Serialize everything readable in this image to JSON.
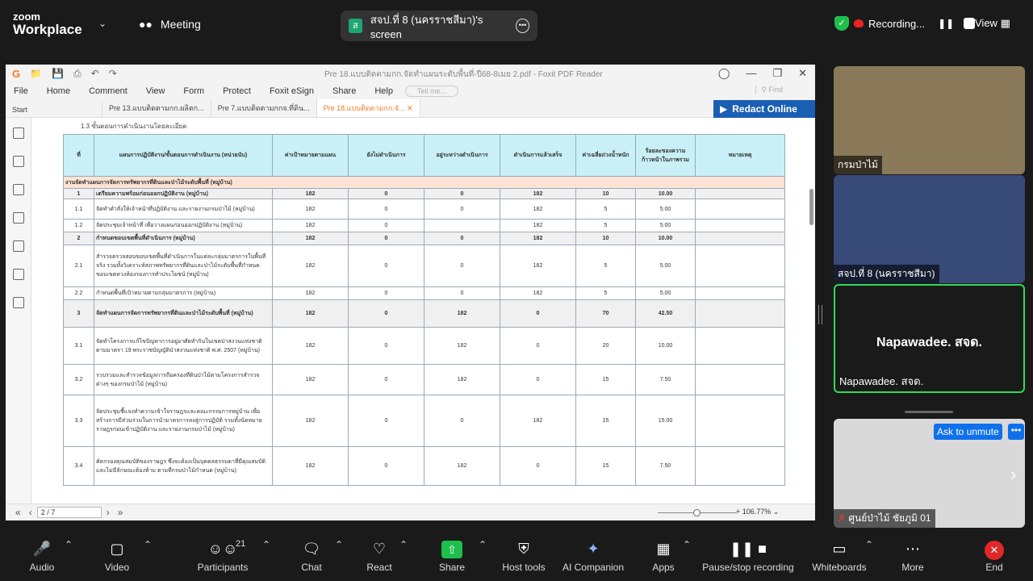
{
  "zoom": {
    "brand_line1": "zoom",
    "brand_line2": "Workplace",
    "meeting_label": "Meeting",
    "share_tab": {
      "avatar_letter": "ส",
      "title": "สจป.ที่ 8 (นครราชสีมา)'s screen"
    },
    "recording_label": "Recording...",
    "view_label": "View"
  },
  "pdf": {
    "window_title": "Pre 18.แบบติดตามกก.จัดทำแผนระดับพื้นที่-ปี68-8เมย 2.pdf - Foxit PDF Reader",
    "menu": [
      "File",
      "Home",
      "Comment",
      "View",
      "Form",
      "Protect",
      "Foxit eSign",
      "Share",
      "Help"
    ],
    "tell_me_placeholder": "Tell me...",
    "find_placeholder": "Find",
    "tabs": [
      "Start",
      "Pre 13.แบบติดตามกก.ผลิตก...",
      "Pre 7.แบบติดตามกกจ.ที่ดิน...",
      "Pre 18.แบบติดตามกก.จั..."
    ],
    "redact_label": "Redact Online",
    "page_indicator": "2 / 7",
    "zoom_level": "106.77%",
    "doc": {
      "subheading": "1.3 ขั้นตอนการดำเนินงานโดยละเอียด",
      "headers": [
        "ที่",
        "แผนการปฏิบัติงาน/ขั้นตอนการดำเนินงาน (หน่วยนับ)",
        "ค่าเป้าหมายตามแผน",
        "ยังไม่ดำเนินการ",
        "อยู่ระหว่างดำเนินการ",
        "ดำเนินการแล้วเสร็จ",
        "ค่าเฉลี่ยถ่วงน้ำหนัก",
        "ร้อยละของความก้าวหน้าในภาพรวม",
        "หมายเหตุ"
      ],
      "section_title": "งานจัดทำแผนการจัดการทรัพยากรที่ดินและป่าไม้ระดับพื้นที่ (หมู่บ้าน)",
      "rows": [
        {
          "no": "1",
          "desc": "เตรียมความพร้อมก่อนออกปฏิบัติงาน (หมู่บ้าน)",
          "target": "182",
          "not_started": "0",
          "in_progress": "0",
          "done": "182",
          "weight": "10",
          "pct": "10.00",
          "bold": true
        },
        {
          "no": "1.1",
          "desc": "จัดทำคำสั่งให้เจ้าหน้าที่ปฏิบัติงาน และรายงานกรมป่าไม้ (หมู่บ้าน)",
          "target": "182",
          "not_started": "0",
          "in_progress": "0",
          "done": "182",
          "weight": "5",
          "pct": "5.00",
          "bold": false
        },
        {
          "no": "1.2",
          "desc": "จัดประชุมเจ้าหน้าที่ เพื่อวางแผนก่อนออกปฏิบัติงาน (หมู่บ้าน)",
          "target": "182",
          "not_started": "0",
          "in_progress": "",
          "done": "182",
          "weight": "5",
          "pct": "5.00",
          "bold": false
        },
        {
          "no": "2",
          "desc": "กำหนดขอบเขตพื้นที่ดำเนินการ (หมู่บ้าน)",
          "target": "182",
          "not_started": "0",
          "in_progress": "0",
          "done": "182",
          "weight": "10",
          "pct": "10.00",
          "bold": true
        },
        {
          "no": "2.1",
          "desc": "สำรวจตรวจสอบขอบเขตพื้นที่ดำเนินการในแต่ละกลุ่มมาตรการในพื้นที่จริง รวมทั้งวิเคราะห์สภาพทรัพยากรที่ดินและป่าไม้ระดับพื้นที่กำหนดขอบเขตหวงห้องรองการทำประโยชน์ (หมู่บ้าน)",
          "target": "182",
          "not_started": "0",
          "in_progress": "0",
          "done": "182",
          "weight": "5",
          "pct": "5.00",
          "bold": false
        },
        {
          "no": "2.2",
          "desc": "กำหนดพื้นที่เป้าหมายตามกลุ่มมาตรการ (หมู่บ้าน)",
          "target": "182",
          "not_started": "0",
          "in_progress": "0",
          "done": "182",
          "weight": "5",
          "pct": "5.00",
          "bold": false
        },
        {
          "no": "3",
          "desc": "จัดทำแผนการจัดการทรัพยากรที่ดินและป่าไม้ระดับพื้นที่ (หมู่บ้าน)",
          "target": "182",
          "not_started": "0",
          "in_progress": "182",
          "done": "0",
          "weight": "70",
          "pct": "42.50",
          "bold": true
        },
        {
          "no": "3.1",
          "desc": "จัดทำโครงการแก้ไขปัญหาการอยู่อาศัยทำกินในเขตป่าสงวนแห่งชาติ ตามมาตรา 19 พระราชบัญญัติป่าสงวนแห่งชาติ พ.ศ. 2507 (หมู่บ้าน)",
          "target": "182",
          "not_started": "0",
          "in_progress": "182",
          "done": "0",
          "weight": "20",
          "pct": "10.00",
          "bold": false
        },
        {
          "no": "3.2",
          "desc": "รวบรวมและสำรวจข้อมูลการถือครองที่ดินป่าไม้ตามโครงการสำรวจต่างๆ ของกรมป่าไม้ (หมู่บ้าน)",
          "target": "182",
          "not_started": "0",
          "in_progress": "182",
          "done": "0",
          "weight": "15",
          "pct": "7.50",
          "bold": false
        },
        {
          "no": "3.3",
          "desc": "จัดประชุมชี้แจงทำความเข้าใจราษฎรและคณะกรรมการหมู่บ้าน เพื่อสร้างการมีส่วนร่วมในการนำมาตรการลงสู่การปฏิบัติ รวมทั้งนัดหมายราษฎรก่อนเข้าปฏิบัติงาน และรายงานกรมป่าไม้ (หมู่บ้าน)",
          "target": "182",
          "not_started": "0",
          "in_progress": "0",
          "done": "182",
          "weight": "15",
          "pct": "15.00",
          "bold": false
        },
        {
          "no": "3.4",
          "desc": "คัดกรองคุณสมบัติของราษฎร ซึ่งจะต้องเป็นบุคคลธรรมดาที่มีคุณสมบัติและไม่มีลักษณะต้องห้าม ตามที่กรมป่าไม้กำหนด (หมู่บ้าน)",
          "target": "182",
          "not_started": "0",
          "in_progress": "182",
          "done": "0",
          "weight": "15",
          "pct": "7.50",
          "bold": false
        }
      ]
    }
  },
  "participants_panel": {
    "tile1_name": "กรมป่าไม้",
    "tile2_name": "สจป.ที่ 8 (นครราชสีมา)",
    "tile3_center": "Napawadee. สจด.",
    "tile3_name": "Napawadee. สจด.",
    "tile4_name": "ศูนย์ป่าไม้ ชัยภูมิ 01",
    "ask_unmute": "Ask to unmute"
  },
  "toolbar": {
    "audio": "Audio",
    "video": "Video",
    "participants": "Participants",
    "participants_count": "21",
    "chat": "Chat",
    "react": "React",
    "share": "Share",
    "host_tools": "Host tools",
    "ai_companion": "AI Companion",
    "apps": "Apps",
    "pause_recording": "Pause/stop recording",
    "whiteboards": "Whiteboards",
    "more": "More",
    "end": "End"
  }
}
